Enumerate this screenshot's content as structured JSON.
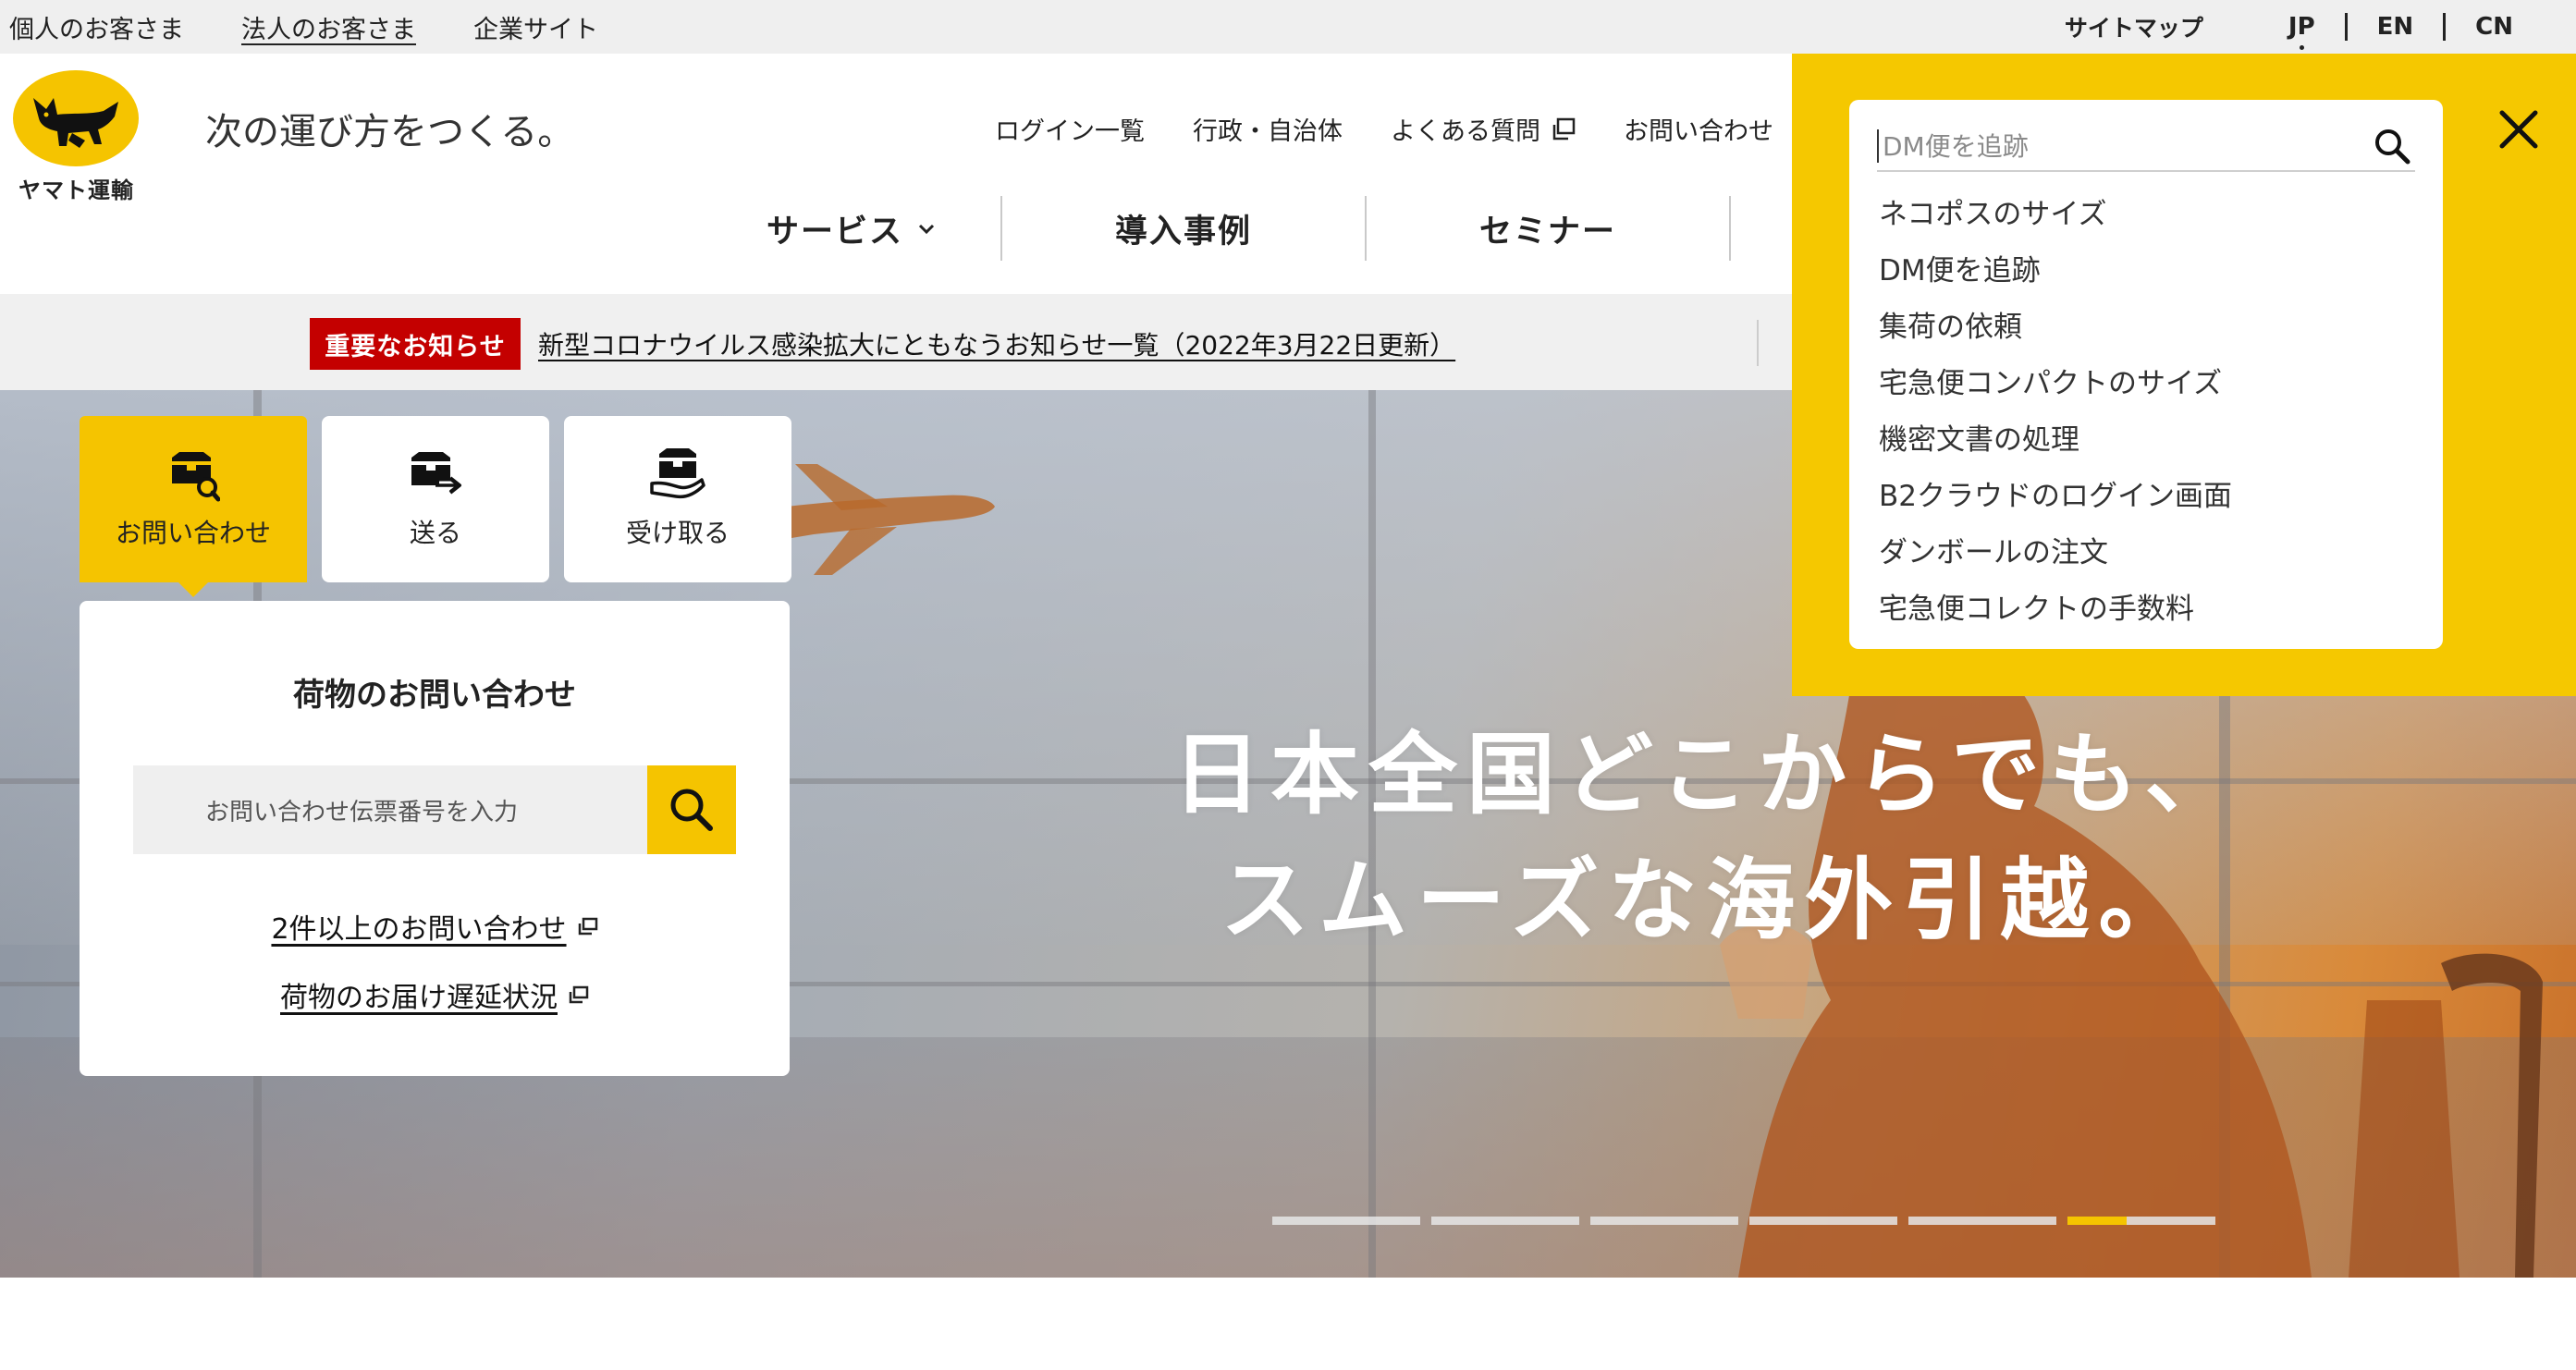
{
  "utility": {
    "links": [
      "個人のお客さま",
      "法人のお客さま",
      "企業サイト"
    ],
    "sitemap": "サイトマップ",
    "languages": [
      "JP",
      "EN",
      "CN"
    ]
  },
  "header": {
    "logo_text": "ヤマト運輸",
    "tagline": "次の運び方をつくる。",
    "subnav": [
      "ログイン一覧",
      "行政・自治体",
      "よくある質問",
      "お問い合わせ"
    ],
    "mainnav": [
      "サービス",
      "導入事例",
      "セミナー"
    ]
  },
  "notice": {
    "label": "重要なお知らせ",
    "link": "新型コロナウイルス感染拡大にともなうお知らせ一覧（2022年3月22日更新）"
  },
  "quick": {
    "tabs": [
      "お問い合わせ",
      "送る",
      "受け取る"
    ],
    "panel_title": "荷物のお問い合わせ",
    "search_placeholder": "お問い合わせ伝票番号を入力",
    "links": [
      "2件以上のお問い合わせ",
      "荷物のお届け遅延状況"
    ]
  },
  "hero": {
    "headline_line1": "日本全国どこからでも、",
    "headline_line2": "スムーズな海外引越。",
    "slides": 6,
    "active_slide": 6,
    "active_progress": 0.4
  },
  "search_overlay": {
    "placeholder": "DM便を追跡",
    "suggestions": [
      "ネコポスのサイズ",
      "DM便を追跡",
      "集荷の依頼",
      "宅急便コンパクトのサイズ",
      "機密文書の処理",
      "B2クラウドのログイン画面",
      "ダンボールの注文",
      "宅急便コレクトの手数料"
    ]
  },
  "colors": {
    "brand_yellow": "#f5c400",
    "notice_red": "#c40000"
  }
}
